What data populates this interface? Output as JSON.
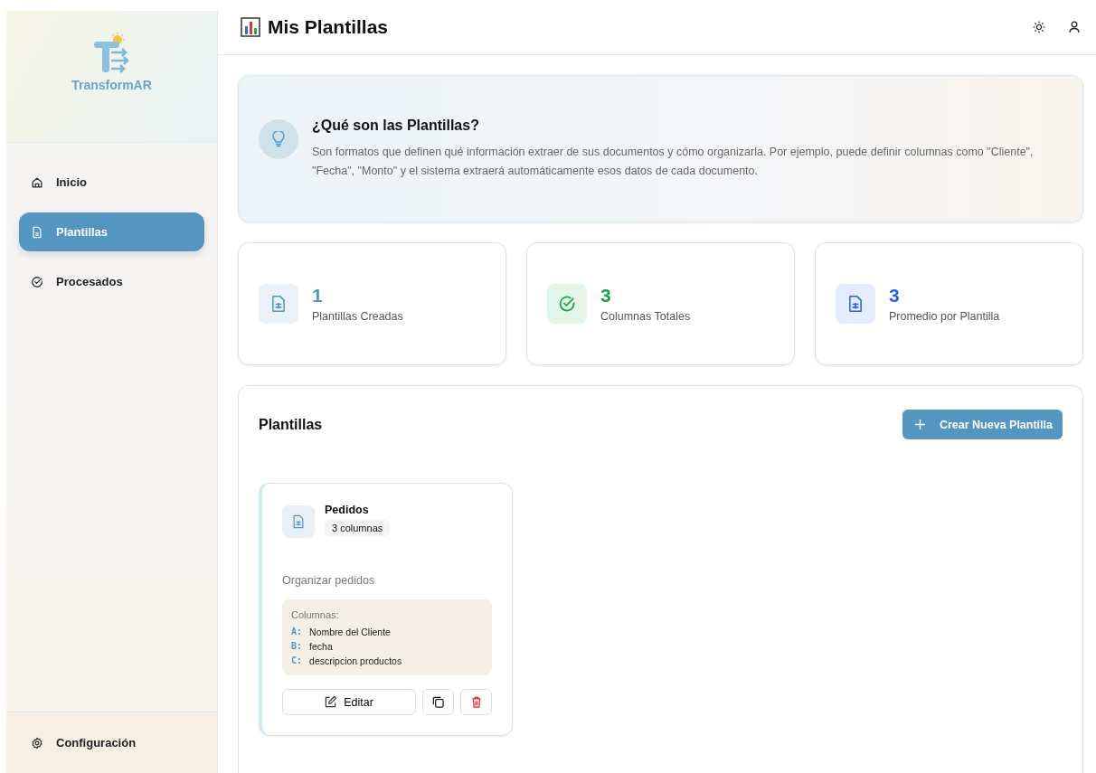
{
  "sidebar": {
    "logo": "TransformAR",
    "items": [
      {
        "label": "Inicio",
        "kind": "home",
        "selected": false
      },
      {
        "label": "Plantillas",
        "kind": "doc",
        "selected": true
      },
      {
        "label": "Procesados",
        "kind": "check",
        "selected": false
      }
    ],
    "footer": {
      "label": "Configuración"
    }
  },
  "header": {
    "title": "Mis Plantillas"
  },
  "info": {
    "title": "¿Qué son las Plantillas?",
    "text": "Son formatos que definen qué información extraer de sus documentos y cómo organizarla. Por ejemplo, puede definir columnas como \"Cliente\", \"Fecha\", \"Monto\" y el sistema extraerá automáticamente esos datos de cada documento."
  },
  "stats": [
    {
      "value": "1",
      "label": "Plantillas Creadas",
      "kind": "doc",
      "color": "#5596c0"
    },
    {
      "value": "3",
      "label": "Columnas Totales",
      "kind": "check",
      "color": "#16a34a"
    },
    {
      "value": "3",
      "label": "Promedio por Plantilla",
      "kind": "doc",
      "color": "#2563eb"
    }
  ],
  "templates": {
    "title": "Plantillas",
    "create_button": "Crear Nueva Plantilla",
    "items": [
      {
        "name": "Pedidos",
        "badge": "3 columnas",
        "description": "Organizar pedidos",
        "columns_label": "Columnas:",
        "columns": [
          {
            "letter": "A:",
            "name": "Nombre del Cliente"
          },
          {
            "letter": "B:",
            "name": "fecha"
          },
          {
            "letter": "C:",
            "name": "descripcion productos"
          }
        ],
        "edit_button": "Editar"
      }
    ]
  }
}
